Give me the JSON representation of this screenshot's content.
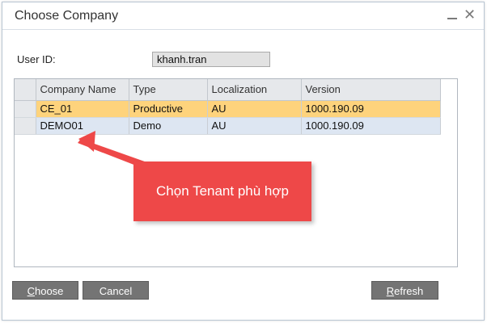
{
  "window": {
    "title": "Choose Company"
  },
  "form": {
    "user_id_label": "User ID:",
    "user_id_value": "khanh.tran"
  },
  "grid": {
    "columns": [
      "",
      "Company Name",
      "Type",
      "Localization",
      "Version"
    ],
    "rows": [
      {
        "company": "CE_01",
        "type": "Productive",
        "localization": "AU",
        "version": "1000.190.09",
        "state": "selected"
      },
      {
        "company": "DEMO01",
        "type": "Demo",
        "localization": "AU",
        "version": "1000.190.09",
        "state": "normal"
      }
    ]
  },
  "buttons": {
    "choose_first": "C",
    "choose_rest": "hoose",
    "cancel": "Cancel",
    "refresh_first": "R",
    "refresh_rest": "efresh"
  },
  "annotation": {
    "text": "Chọn Tenant phù hợp",
    "color": "#ee4848"
  },
  "colors": {
    "selected_row": "#fed37c",
    "alt_row": "#dde6f2",
    "button": "#747474"
  },
  "icons": {
    "minimize": "minimize-icon",
    "close": "close-icon"
  }
}
